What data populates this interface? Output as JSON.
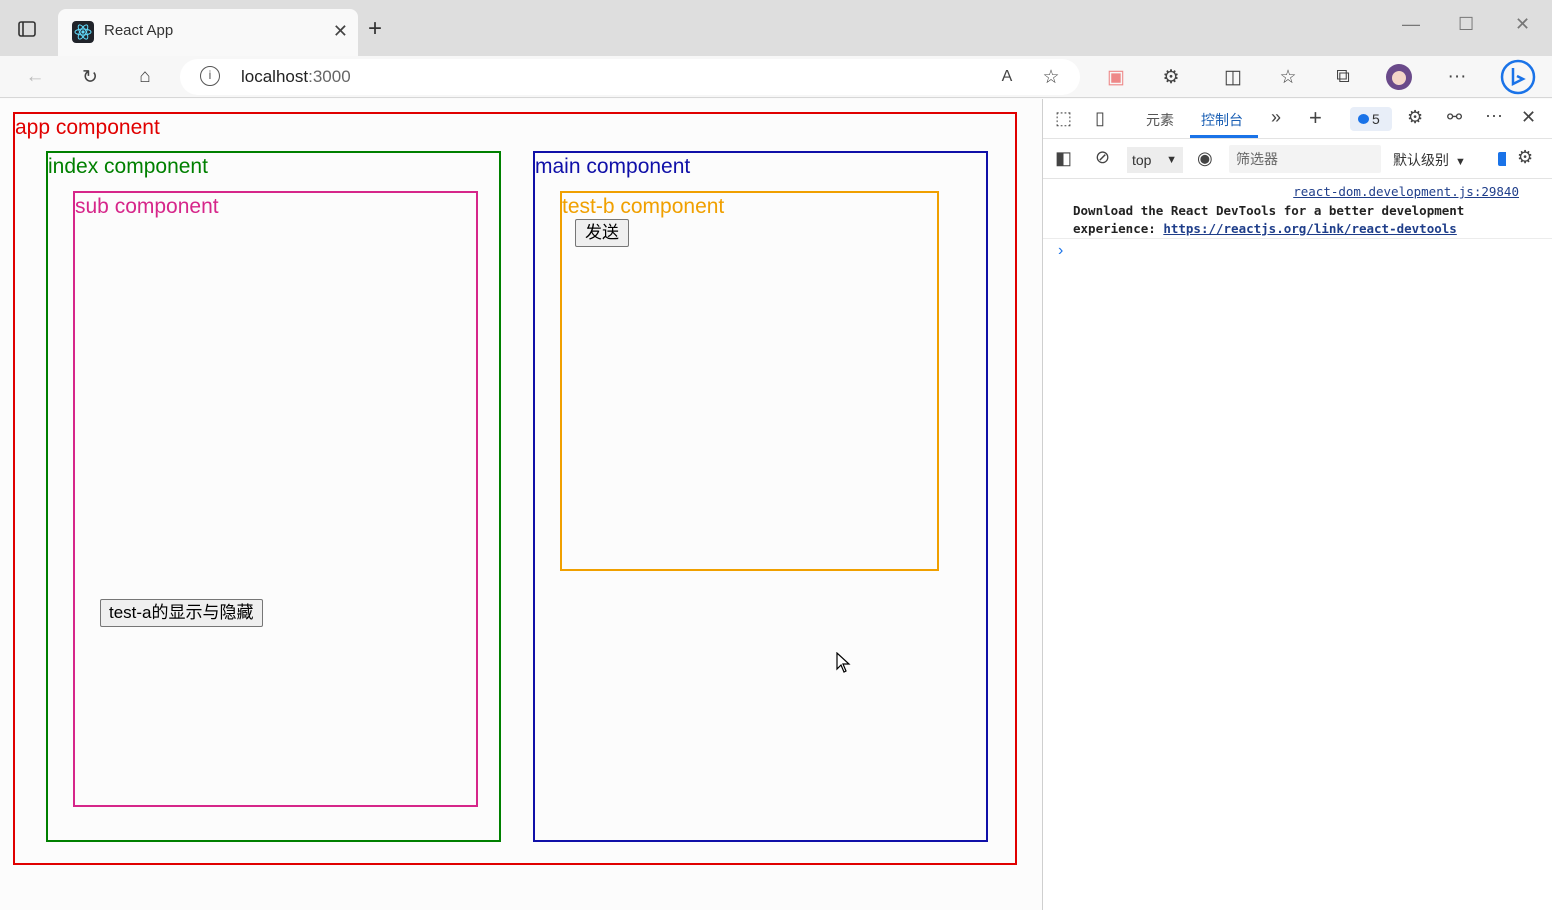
{
  "browser": {
    "tab_title": "React App",
    "url_host": "localhost",
    "url_port": ":3000"
  },
  "page": {
    "app_label": "app component",
    "index_label": "index component",
    "sub_label": "sub component",
    "main_label": "main component",
    "testb_label": "test-b component",
    "toggle_button": "test-a的显示与隐藏",
    "send_button": "发送"
  },
  "colors": {
    "app": "#e00000",
    "index": "#008000",
    "sub": "#d6268a",
    "main": "#1010a8",
    "testb": "#f0a000"
  },
  "devtools": {
    "tabs": [
      "元素",
      "控制台"
    ],
    "active_tab": "控制台",
    "badge_count": "5",
    "context": "top",
    "filter_placeholder": "筛选器",
    "level": "默认级别",
    "message": {
      "source": "react-dom.development.js:29840",
      "text_line1": "Download the React DevTools for a better development",
      "text_line2_prefix": "experience: ",
      "link": "https://reactjs.org/link/react-devtools"
    }
  }
}
